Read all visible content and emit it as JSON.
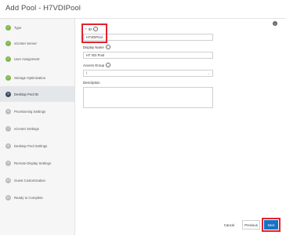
{
  "window": {
    "title": "Add Pool - H7VDIPool"
  },
  "sidebar": {
    "steps": [
      {
        "label": "Type",
        "state": "done"
      },
      {
        "label": "vCenter Server",
        "state": "done"
      },
      {
        "label": "User Assignment",
        "state": "done"
      },
      {
        "label": "Storage Optimization",
        "state": "done"
      },
      {
        "label": "Desktop Pool ID",
        "state": "current",
        "number": "5"
      },
      {
        "label": "Provisioning Settings",
        "state": "pending",
        "number": "6"
      },
      {
        "label": "vCenter Settings",
        "state": "pending",
        "number": "7"
      },
      {
        "label": "Desktop Pool Settings",
        "state": "pending",
        "number": "8"
      },
      {
        "label": "Remote Display Settings",
        "state": "pending",
        "number": "9"
      },
      {
        "label": "Guest Customization",
        "state": "pending",
        "number": "10"
      },
      {
        "label": "Ready to Complete",
        "state": "pending",
        "number": "11"
      }
    ]
  },
  "form": {
    "id": {
      "required_mark": "*",
      "label": "ID",
      "value": "H7VDIPool"
    },
    "display_name": {
      "label": "Display Name",
      "value": "H7 VDI Pool"
    },
    "access_group": {
      "label": "Access Group",
      "value": "/"
    },
    "description": {
      "label": "Description",
      "value": ""
    }
  },
  "footer": {
    "cancel_label": "Cancel",
    "previous_label": "Previous",
    "next_label": "Next"
  },
  "colors": {
    "accent": "#1773c3",
    "highlight": "#e3222e",
    "done": "#7fb84b",
    "current": "#3a4a5a",
    "pending": "#b7bcc1"
  }
}
